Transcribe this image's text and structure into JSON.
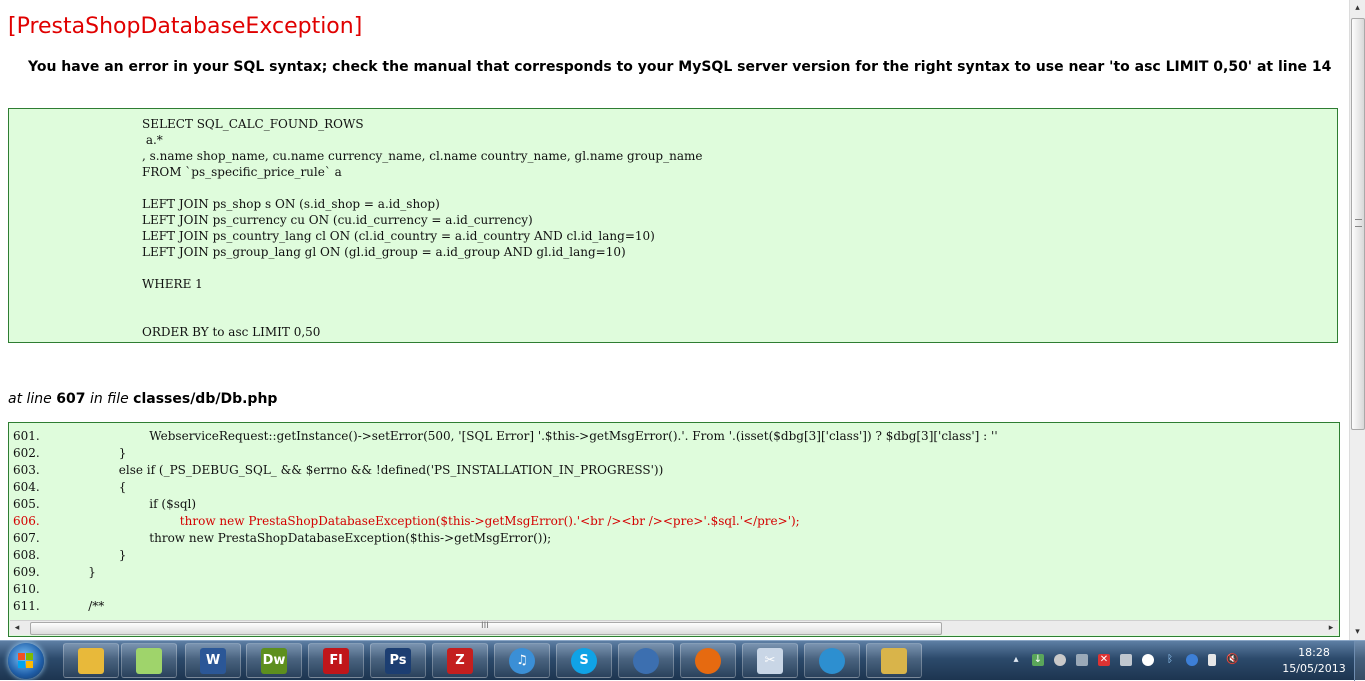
{
  "error": {
    "title": "[PrestaShopDatabaseException]",
    "message": "You have an error in your SQL syntax; check the manual that corresponds to your MySQL server version for the right syntax to use near 'to asc LIMIT 0,50' at line 14"
  },
  "sql": {
    "query": "SELECT SQL_CALC_FOUND_ROWS\n a.*\n, s.name shop_name, cu.name currency_name, cl.name country_name, gl.name group_name\nFROM `ps_specific_price_rule` a\n\nLEFT JOIN ps_shop s ON (s.id_shop = a.id_shop)\nLEFT JOIN ps_currency cu ON (cu.id_currency = a.id_currency)\nLEFT JOIN ps_country_lang cl ON (cl.id_country = a.id_country AND cl.id_lang=10)\nLEFT JOIN ps_group_lang gl ON (gl.id_group = a.id_group AND gl.id_lang=10)\n\nWHERE 1\n\n\nORDER BY to asc LIMIT 0,50"
  },
  "location": {
    "prefix": "at line",
    "line": "607",
    "in_file": "in file",
    "file": "classes/db/Db.php"
  },
  "code": {
    "lines": [
      {
        "num": "601.",
        "text": "                    WebserviceRequest::getInstance()->setError(500, '[SQL Error] '.$this->getMsgError().'. From '.(isset($dbg[3]['class']) ? $dbg[3]['class'] : ''"
      },
      {
        "num": "602.",
        "text": "            }"
      },
      {
        "num": "603.",
        "text": "            else if (_PS_DEBUG_SQL_ && $errno && !defined('PS_INSTALLATION_IN_PROGRESS'))"
      },
      {
        "num": "604.",
        "text": "            {"
      },
      {
        "num": "605.",
        "text": "                    if ($sql)"
      },
      {
        "num": "606.",
        "text": "                            throw new PrestaShopDatabaseException($this->getMsgError().'<br /><br /><pre>'.$sql.'</pre>');",
        "highlight": true
      },
      {
        "num": "607.",
        "text": "                    throw new PrestaShopDatabaseException($this->getMsgError());"
      },
      {
        "num": "608.",
        "text": "            }"
      },
      {
        "num": "609.",
        "text": "    }"
      },
      {
        "num": "610.",
        "text": ""
      },
      {
        "num": "611.",
        "text": "    /**"
      }
    ]
  },
  "colors": {
    "title": "#e00000",
    "box_bg": "#dffcdc",
    "box_border": "#2e7d32",
    "highlight": "#d40000"
  },
  "taskbar": {
    "apps": [
      {
        "name": "explorer",
        "icon": "folder-icon",
        "label": "",
        "color": "#e8b93a"
      },
      {
        "name": "sticky-notes",
        "icon": "notes-icon",
        "label": "",
        "color": "#9fd46b"
      },
      {
        "name": "word",
        "icon": "word-icon",
        "label": "W",
        "color": "#2b5797"
      },
      {
        "name": "dreamweaver",
        "icon": "dreamweaver-icon",
        "label": "Dw",
        "color": "#5d8f1e"
      },
      {
        "name": "flash",
        "icon": "flash-icon",
        "label": "Fl",
        "color": "#c0161a"
      },
      {
        "name": "photoshop",
        "icon": "photoshop-icon",
        "label": "Ps",
        "color": "#1c3e72"
      },
      {
        "name": "filezilla",
        "icon": "filezilla-icon",
        "label": "Z",
        "color": "#c41f1f"
      },
      {
        "name": "itunes",
        "icon": "itunes-icon",
        "label": "♫",
        "color": "#3b8fd6"
      },
      {
        "name": "skype",
        "icon": "skype-icon",
        "label": "S",
        "color": "#10a3e6"
      },
      {
        "name": "thunderbird",
        "icon": "thunderbird-icon",
        "label": "",
        "color": "#3c6fb0"
      },
      {
        "name": "firefox",
        "icon": "firefox-icon",
        "label": "",
        "color": "#e66a10"
      },
      {
        "name": "snipping-tool",
        "icon": "scissors-icon",
        "label": "✂",
        "color": "#c9d6e6"
      },
      {
        "name": "network",
        "icon": "globe-icon",
        "label": "",
        "color": "#2d8fd0"
      },
      {
        "name": "image-viewer",
        "icon": "picture-icon",
        "label": "",
        "color": "#d9b44a"
      }
    ],
    "clock_time": "18:28",
    "clock_date": "15/05/2013"
  }
}
